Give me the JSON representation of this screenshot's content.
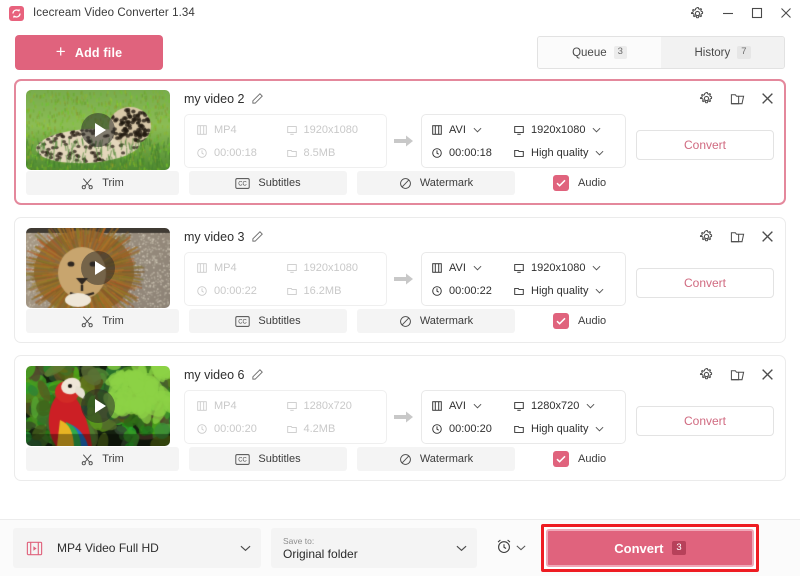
{
  "window": {
    "title": "Icecream Video Converter 1.34",
    "logo_icon": "icecream-logo-icon",
    "controls": [
      {
        "name": "settings",
        "icon": "gear-icon"
      },
      {
        "name": "minimize",
        "icon": "minimize-icon"
      },
      {
        "name": "maximize",
        "icon": "maximize-icon"
      },
      {
        "name": "close",
        "icon": "close-icon"
      }
    ]
  },
  "toolbar": {
    "add_file_label": "Add file",
    "add_file_icon": "plus-icon",
    "tabs": [
      {
        "label": "Queue",
        "count": "3",
        "active": true
      },
      {
        "label": "History",
        "count": "7",
        "active": false
      }
    ]
  },
  "cards": [
    {
      "selected": true,
      "name": "my video 2",
      "edit_icon": "pencil-icon",
      "thumb": "cheetah-thumbnail",
      "source": {
        "format": "MP4",
        "duration": "00:00:18",
        "resolution": "1920x1080",
        "size": "8.5MB"
      },
      "output": {
        "format": "AVI",
        "duration": "00:00:18",
        "resolution": "1920x1080",
        "quality": "High quality"
      },
      "convert_label": "Convert",
      "actions": {
        "trim": "Trim",
        "subtitles": "Subtitles",
        "watermark": "Watermark",
        "audio": "Audio"
      },
      "icons": [
        "gear-icon",
        "folder-icon",
        "close-icon"
      ]
    },
    {
      "selected": false,
      "name": "my video 3",
      "edit_icon": "pencil-icon",
      "thumb": "lion-thumbnail",
      "source": {
        "format": "MP4",
        "duration": "00:00:22",
        "resolution": "1920x1080",
        "size": "16.2MB"
      },
      "output": {
        "format": "AVI",
        "duration": "00:00:22",
        "resolution": "1920x1080",
        "quality": "High quality"
      },
      "convert_label": "Convert",
      "actions": {
        "trim": "Trim",
        "subtitles": "Subtitles",
        "watermark": "Watermark",
        "audio": "Audio"
      },
      "icons": [
        "gear-icon",
        "folder-icon",
        "close-icon"
      ]
    },
    {
      "selected": false,
      "name": "my video 6",
      "edit_icon": "pencil-icon",
      "thumb": "parrot-thumbnail",
      "source": {
        "format": "MP4",
        "duration": "00:00:20",
        "resolution": "1280x720",
        "size": "4.2MB"
      },
      "output": {
        "format": "AVI",
        "duration": "00:00:20",
        "resolution": "1280x720",
        "quality": "High quality"
      },
      "convert_label": "Convert",
      "actions": {
        "trim": "Trim",
        "subtitles": "Subtitles",
        "watermark": "Watermark",
        "audio": "Audio"
      },
      "icons": [
        "gear-icon",
        "folder-icon",
        "close-icon"
      ]
    }
  ],
  "bottombar": {
    "format_preset": "MP4 Video Full HD",
    "format_icon": "video-file-icon",
    "save_to_caption": "Save to:",
    "save_to_value": "Original folder",
    "timer_icon": "alarm-clock-icon",
    "convert_label": "Convert",
    "convert_count": "3"
  },
  "colors": {
    "accent": "#e0637d",
    "accent_text": "#d06a80",
    "highlight_box": "#ee1c22",
    "selected_border": "#e4889c",
    "muted_text": "#c9c9c9"
  }
}
